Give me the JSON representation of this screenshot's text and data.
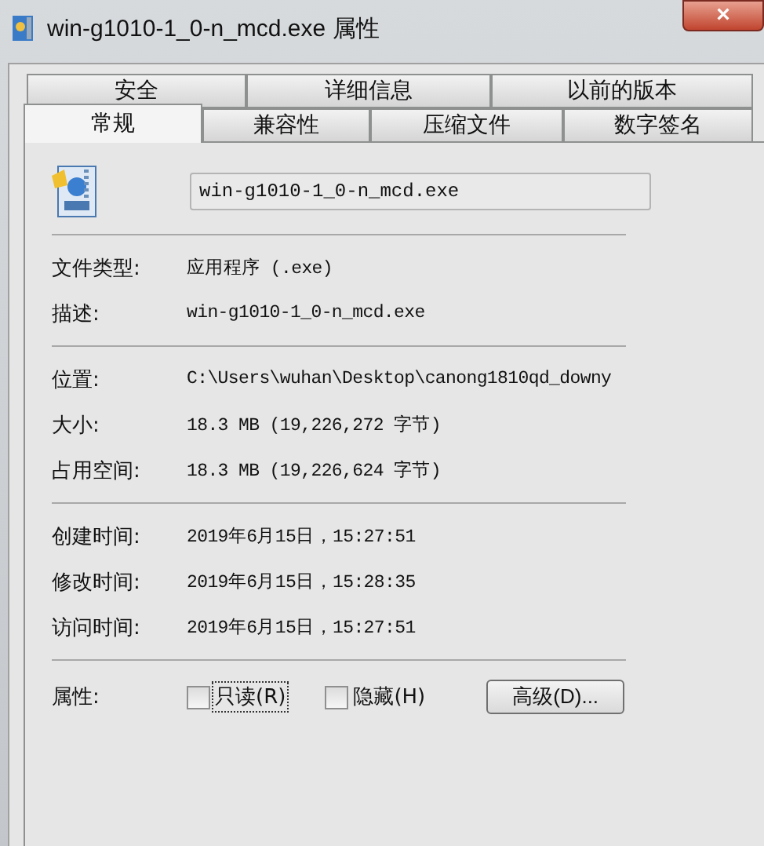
{
  "window": {
    "title": "win-g1010-1_0-n_mcd.exe 属性",
    "close": "×"
  },
  "tabs": [
    [
      {
        "label": "安全",
        "selected": false
      },
      {
        "label": "详细信息",
        "selected": false
      },
      {
        "label": "以前的版本",
        "selected": false
      }
    ],
    [
      {
        "label": "常规",
        "selected": true
      },
      {
        "label": "兼容性",
        "selected": false
      },
      {
        "label": "压缩文件",
        "selected": false
      },
      {
        "label": "数字签名",
        "selected": false
      }
    ]
  ],
  "file_name": "win-g1010-1_0-n_mcd.exe",
  "sections": [
    [
      {
        "label": "文件类型:",
        "value": "应用程序 (.exe)"
      },
      {
        "label": "描述:",
        "value": "win-g1010-1_0-n_mcd.exe"
      }
    ],
    [
      {
        "label": "位置:",
        "value": "C:\\Users\\wuhan\\Desktop\\canong1810qd_downy"
      },
      {
        "label": "大小:",
        "value": "18.3 MB (19,226,272 字节)"
      },
      {
        "label": "占用空间:",
        "value": "18.3 MB (19,226,624 字节)"
      }
    ],
    [
      {
        "label": "创建时间:",
        "value": "2019年6月15日，15:27:51"
      },
      {
        "label": "修改时间:",
        "value": "2019年6月15日，15:28:35"
      },
      {
        "label": "访问时间:",
        "value": "2019年6月15日，15:27:51"
      }
    ]
  ],
  "attributes": {
    "label": "属性:",
    "options": [
      {
        "label": "只读(R)",
        "checked": false,
        "focused": true
      },
      {
        "label": "隐藏(H)",
        "checked": false,
        "focused": false
      }
    ],
    "advanced_button": "高级(D)..."
  }
}
